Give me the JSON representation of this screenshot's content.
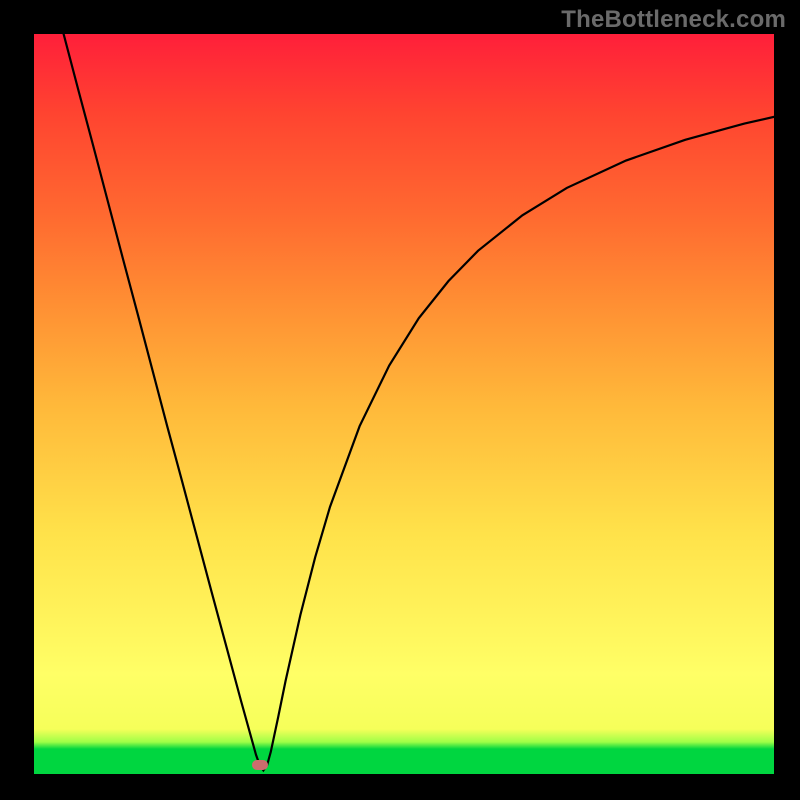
{
  "watermark": "TheBottleneck.com",
  "chart_data": {
    "type": "line",
    "title": "",
    "xlabel": "",
    "ylabel": "",
    "xlim": [
      0,
      1
    ],
    "ylim": [
      0,
      1
    ],
    "series": [
      {
        "name": "bottleneck-curve",
        "x": [
          0.04,
          0.06,
          0.08,
          0.1,
          0.12,
          0.14,
          0.16,
          0.18,
          0.2,
          0.22,
          0.24,
          0.26,
          0.28,
          0.3,
          0.305,
          0.31,
          0.315,
          0.32,
          0.33,
          0.34,
          0.36,
          0.38,
          0.4,
          0.44,
          0.48,
          0.52,
          0.56,
          0.6,
          0.66,
          0.72,
          0.8,
          0.88,
          0.96,
          1.0
        ],
        "y": [
          1.0,
          0.924,
          0.849,
          0.773,
          0.697,
          0.622,
          0.546,
          0.47,
          0.396,
          0.321,
          0.246,
          0.172,
          0.098,
          0.026,
          0.012,
          0.005,
          0.012,
          0.03,
          0.077,
          0.126,
          0.215,
          0.293,
          0.361,
          0.47,
          0.552,
          0.616,
          0.666,
          0.707,
          0.755,
          0.792,
          0.829,
          0.857,
          0.879,
          0.888
        ]
      }
    ],
    "marker": {
      "x": 0.305,
      "y": 0.012,
      "color": "#cc6d6d"
    },
    "background_gradient": [
      "#00d640",
      "#9fff47",
      "#ffff66",
      "#ffb83a",
      "#ff6930",
      "#ff1f3a"
    ]
  }
}
